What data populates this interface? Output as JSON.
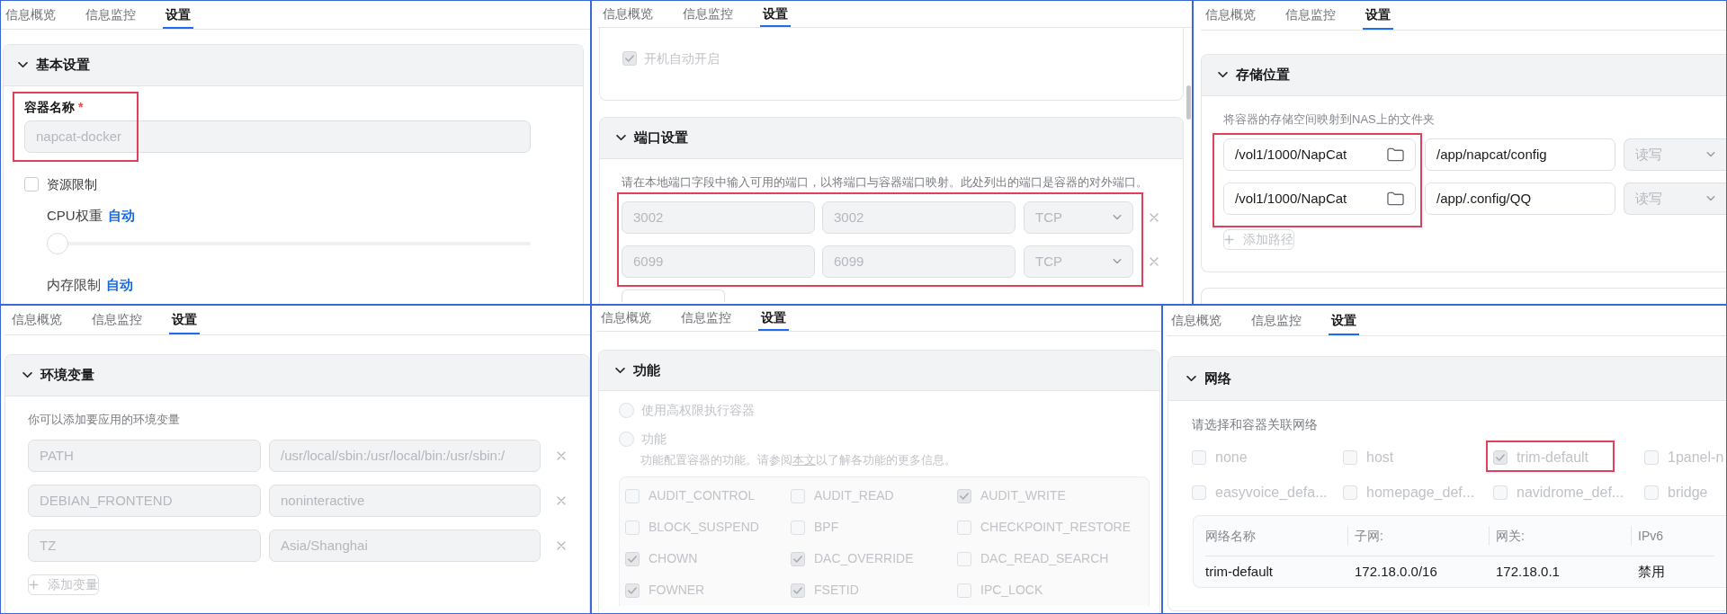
{
  "rows": [
    {
      "panels": [
        {
          "kind": "basic",
          "tabs": [
            {
              "label": "信息概览",
              "selected": false
            },
            {
              "label": "信息监控",
              "selected": false
            },
            {
              "label": "设置",
              "selected": true
            }
          ],
          "section": {
            "title": "基本设置",
            "expanded": true
          },
          "name_field": {
            "label": "容器名称",
            "required_mark": "*",
            "value": "napcat-docker",
            "disabled": true,
            "highlighted": true
          },
          "resource_limit": {
            "label": "资源限制",
            "checked": false
          },
          "limits": [
            {
              "kind": "slider",
              "label": "CPU权重",
              "value": "自动",
              "level": 0
            },
            {
              "kind": "text",
              "label": "内存限制",
              "value": "自动"
            }
          ]
        },
        {
          "kind": "ports",
          "tabs": [
            {
              "label": "信息概览",
              "selected": false
            },
            {
              "label": "信息监控",
              "selected": false
            },
            {
              "label": "设置",
              "selected": true
            }
          ],
          "autostart": {
            "label": "开机自动开启",
            "checked": true,
            "disabled": true
          },
          "section": {
            "title": "端口设置",
            "expanded": true
          },
          "description": "请在本地端口字段中输入可用的端口，以将端口与容器端口映射。此处列出的端口是容器的对外端口。",
          "ports_highlighted": true,
          "ports": [
            {
              "local_port": "3002",
              "container_port": "3002",
              "protocol": "TCP",
              "disabled": true
            },
            {
              "local_port": "6099",
              "container_port": "6099",
              "protocol": "TCP",
              "disabled": true
            }
          ]
        },
        {
          "kind": "storage",
          "tabs": [
            {
              "label": "信息概览",
              "selected": false
            },
            {
              "label": "信息监控",
              "selected": false
            },
            {
              "label": "设置",
              "selected": true
            }
          ],
          "section": {
            "title": "存储位置",
            "expanded": true
          },
          "description": "将容器的存储空间映射到NAS上的文件夹",
          "host_paths_highlighted": true,
          "mounts": [
            {
              "host_path": "/vol1/1000/NapCat",
              "container_path": "/app/napcat/config",
              "mode": "读写",
              "mode_disabled": true
            },
            {
              "host_path": "/vol1/1000/NapCat",
              "container_path": "/app/.config/QQ",
              "mode": "读写",
              "mode_disabled": true
            }
          ],
          "add_button": {
            "label": "添加路径",
            "disabled": true
          }
        }
      ]
    },
    {
      "panels": [
        {
          "kind": "env",
          "tabs": [
            {
              "label": "信息概览",
              "selected": false
            },
            {
              "label": "信息监控",
              "selected": false
            },
            {
              "label": "设置",
              "selected": true
            }
          ],
          "section": {
            "title": "环境变量",
            "expanded": true
          },
          "description": "你可以添加要应用的环境变量",
          "variables": [
            {
              "name": "PATH",
              "value": "/usr/local/sbin:/usr/local/bin:/usr/sbin:/",
              "disabled": true
            },
            {
              "name": "DEBIAN_FRONTEND",
              "value": "noninteractive",
              "disabled": true
            },
            {
              "name": "TZ",
              "value": "Asia/Shanghai",
              "disabled": true
            }
          ],
          "add_button": {
            "label": "添加变量",
            "disabled": true
          }
        },
        {
          "kind": "capabilities",
          "tabs": [
            {
              "label": "信息概览",
              "selected": false
            },
            {
              "label": "信息监控",
              "selected": false
            },
            {
              "label": "设置",
              "selected": true
            }
          ],
          "section": {
            "title": "功能",
            "expanded": true
          },
          "disabled": true,
          "modes": [
            {
              "label": "使用高权限执行容器",
              "selected": false
            },
            {
              "label": "功能",
              "selected": false
            }
          ],
          "description": {
            "before": "功能配置容器的功能。请参阅",
            "link": "本文",
            "after": "以了解各功能的更多信息。"
          },
          "capabilities": [
            {
              "label": "AUDIT_CONTROL",
              "checked": false
            },
            {
              "label": "AUDIT_READ",
              "checked": false
            },
            {
              "label": "AUDIT_WRITE",
              "checked": true
            },
            {
              "label": "BLOCK_SUSPEND",
              "checked": false
            },
            {
              "label": "BPF",
              "checked": false
            },
            {
              "label": "CHECKPOINT_RESTORE",
              "checked": false
            },
            {
              "label": "CHOWN",
              "checked": true
            },
            {
              "label": "DAC_OVERRIDE",
              "checked": true
            },
            {
              "label": "DAC_READ_SEARCH",
              "checked": false
            },
            {
              "label": "FOWNER",
              "checked": true
            },
            {
              "label": "FSETID",
              "checked": true
            },
            {
              "label": "IPC_LOCK",
              "checked": false
            }
          ]
        },
        {
          "kind": "network",
          "tabs": [
            {
              "label": "信息概览",
              "selected": false
            },
            {
              "label": "信息监控",
              "selected": false
            },
            {
              "label": "设置",
              "selected": true
            }
          ],
          "section": {
            "title": "网络",
            "expanded": true
          },
          "description": "请选择和容器关联网络",
          "disabled": true,
          "networks": [
            {
              "label": "none",
              "checked": false,
              "highlighted": false
            },
            {
              "label": "host",
              "checked": false,
              "highlighted": false
            },
            {
              "label": "trim-default",
              "checked": true,
              "highlighted": true
            },
            {
              "label": "1panel-n",
              "checked": false,
              "highlighted": false
            },
            {
              "label": "easyvoice_defa...",
              "checked": false,
              "highlighted": false
            },
            {
              "label": "homepage_def...",
              "checked": false,
              "highlighted": false
            },
            {
              "label": "navidrome_def...",
              "checked": false,
              "highlighted": false
            },
            {
              "label": "bridge",
              "checked": false,
              "highlighted": false
            }
          ],
          "table": {
            "columns": [
              "网络名称",
              "子网:",
              "网关:",
              "IPv6"
            ],
            "rows": [
              [
                "trim-default",
                "172.18.0.0/16",
                "172.18.0.1",
                "禁用"
              ]
            ]
          }
        }
      ]
    }
  ]
}
